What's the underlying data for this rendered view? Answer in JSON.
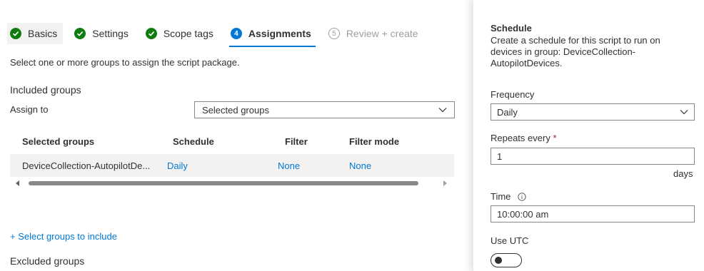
{
  "wizard": {
    "steps": [
      {
        "label": "Basics",
        "state": "done"
      },
      {
        "label": "Settings",
        "state": "done"
      },
      {
        "label": "Scope tags",
        "state": "done"
      },
      {
        "label": "Assignments",
        "state": "current",
        "number": "4"
      },
      {
        "label": "Review + create",
        "state": "future",
        "number": "5"
      }
    ]
  },
  "assignments": {
    "description": "Select one or more groups to assign the script package.",
    "included_title": "Included groups",
    "assign_to_label": "Assign to",
    "assign_to_value": "Selected groups",
    "table": {
      "headers": [
        "Selected groups",
        "Schedule",
        "Filter",
        "Filter mode"
      ],
      "rows": [
        [
          "DeviceCollection-AutopilotDe...",
          "Daily",
          "None",
          "None"
        ]
      ]
    },
    "add_link": "+ Select groups to include",
    "excluded_title": "Excluded groups"
  },
  "schedule": {
    "title": "Schedule",
    "description": "Create a schedule for this script to run on devices in group: DeviceCollection-AutopilotDevices.",
    "frequency_label": "Frequency",
    "frequency_value": "Daily",
    "repeats_label": "Repeats every",
    "required_mark": "*",
    "repeats_value": "1",
    "repeats_unit": "days",
    "time_label": "Time",
    "time_value": "10:00:00 am",
    "utc_label": "Use UTC",
    "utc_enabled": false
  },
  "colors": {
    "accent": "#0078d4",
    "success": "#107c10",
    "required": "#a4262c"
  }
}
